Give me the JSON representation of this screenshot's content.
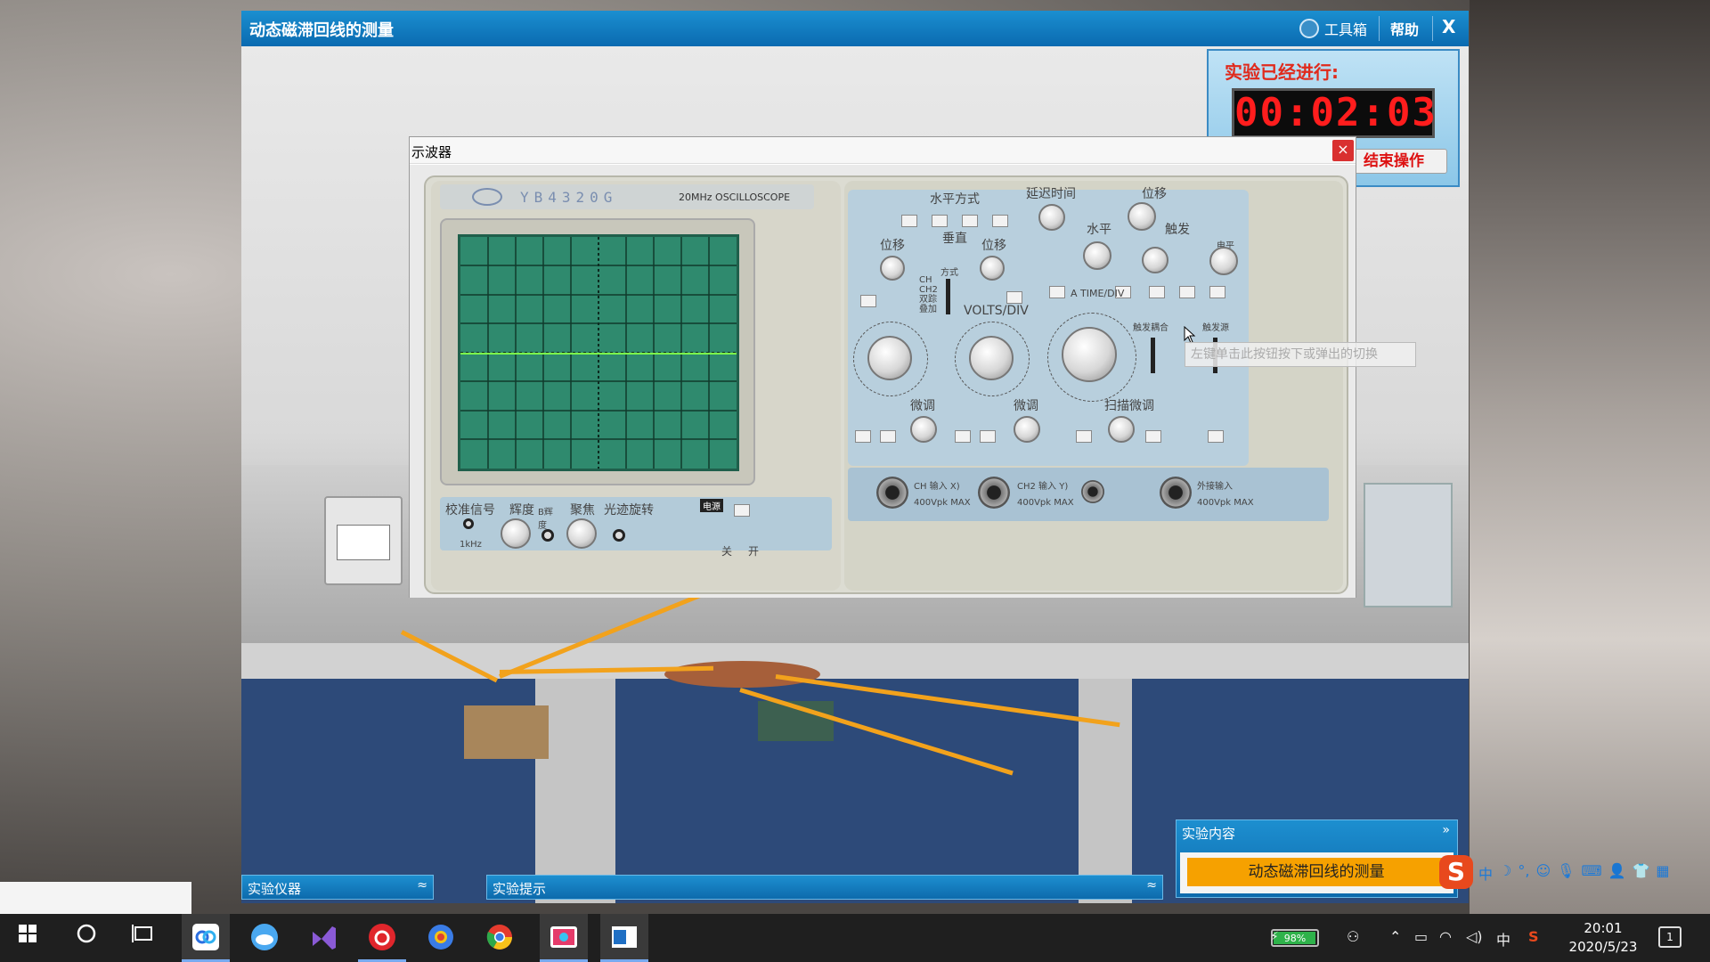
{
  "app": {
    "title": "动态磁滞回线的测量",
    "toolbox_label": "工具箱",
    "help_label": "帮助",
    "close_label": "X"
  },
  "timer": {
    "label": "实验已经进行:",
    "value": "00:02:03",
    "end_button": "结束操作"
  },
  "dialog": {
    "title": "示波器",
    "close_label": "×"
  },
  "oscilloscope": {
    "model": "YB4320G",
    "model_sub": "20MHz  OSCILLOSCOPE",
    "left_labels": {
      "calibration": "校准信号",
      "calibration_freq": "1kHz",
      "brightness": "辉度",
      "b_brightness": "B辉度",
      "focus": "聚焦",
      "trace_rotation": "光迹旋转",
      "power": "电源",
      "off": "关",
      "on": "开"
    },
    "right_labels": {
      "horizontal_mode": "水平方式",
      "delay_time": "延迟时间",
      "position": "位移",
      "vertical": "垂直",
      "position_ch1": "位移",
      "position_ch2": "位移",
      "horizontal": "水平",
      "trigger": "触发",
      "level": "电平",
      "mode": "方式",
      "mode_options": "CH CH2 双踪 叠加",
      "volts_div": "VOLTS/DIV",
      "time_div": "A TIME/DIV",
      "trigger_coupling": "触发耦合",
      "trigger_source": "触发源",
      "fine_ch1": "微调",
      "fine_ch2": "微调",
      "sweep_fine": "扫描微调",
      "ch1_input": "CH  输入  X)",
      "ch2_input": "CH2 输入  Y)",
      "ext_input": "外接输入",
      "max_voltage": "400Vpk MAX"
    }
  },
  "tooltip": "左键单击此按钮按下或弹出的切换",
  "panels": {
    "instruments": "实验仪器",
    "hints": "实验提示",
    "content_header": "实验内容",
    "content_item": "动态磁滞回线的测量",
    "chevron_up": "≈",
    "chevron_down": "»"
  },
  "ime": {
    "logo": "S",
    "items": [
      "中",
      "☽",
      "°,",
      "☺",
      "🎙",
      "⌨",
      "👤",
      "👕",
      "▦"
    ]
  },
  "taskbar": {
    "battery": "98%",
    "battery_level": 0.98,
    "ime_mode": "中",
    "time": "20:01",
    "date": "2020/5/23",
    "notifications": "1"
  }
}
